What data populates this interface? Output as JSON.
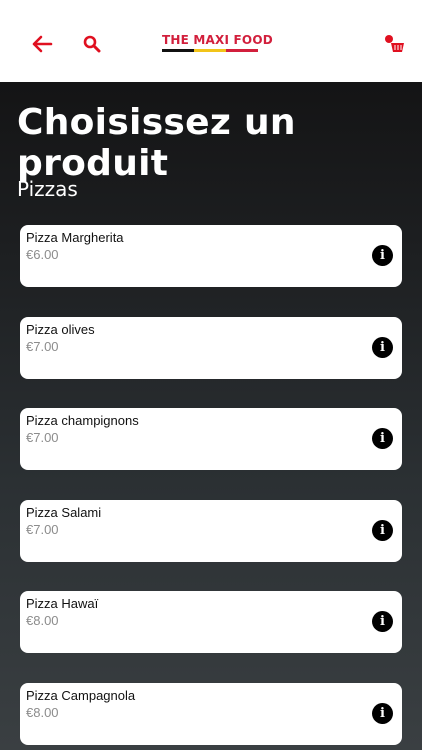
{
  "header": {
    "logo_text": "THE MAXI FOOD",
    "logo_stripe_colors": [
      "#111111",
      "#f2c419",
      "#d21f3c"
    ],
    "accent_color": "#e01020",
    "icons": [
      "back-arrow-icon",
      "search-icon",
      "cart-icon"
    ]
  },
  "page": {
    "title": "Choisissez un produit",
    "section": "Pizzas"
  },
  "products": [
    {
      "name": "Pizza Margherita",
      "price": "€6.00"
    },
    {
      "name": "Pizza olives",
      "price": "€7.00"
    },
    {
      "name": "Pizza champignons",
      "price": "€7.00"
    },
    {
      "name": "Pizza Salami",
      "price": "€7.00"
    },
    {
      "name": "Pizza Hawaï",
      "price": "€8.00"
    },
    {
      "name": "Pizza Campagnola",
      "price": "€8.00"
    }
  ],
  "info_glyph": "i"
}
